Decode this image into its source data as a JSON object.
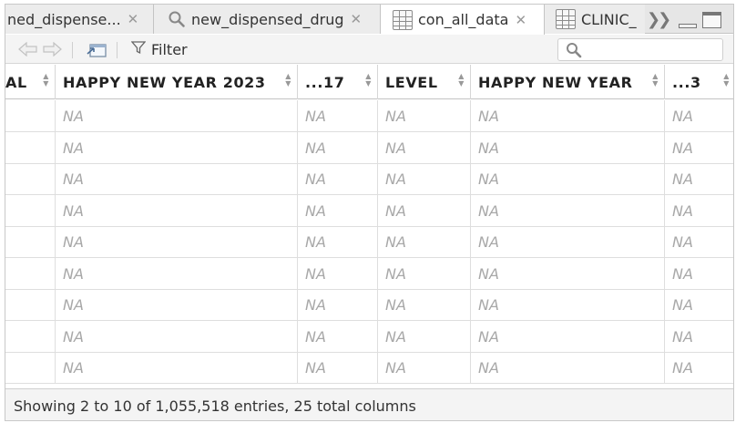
{
  "tabs": [
    {
      "label": "ned_dispense...",
      "icon": "none",
      "closable": true
    },
    {
      "label": "new_dispensed_drug",
      "icon": "search-icon",
      "closable": true
    },
    {
      "label": "con_all_data",
      "icon": "table-grid-icon",
      "closable": true,
      "active": true
    },
    {
      "label": "CLINIC_",
      "icon": "table-grid-icon",
      "closable": false
    }
  ],
  "toolbar": {
    "filter_label": "Filter",
    "search_value": ""
  },
  "table": {
    "columns": [
      {
        "label": "AL"
      },
      {
        "label": "HAPPY NEW YEAR 2023"
      },
      {
        "label": "...17"
      },
      {
        "label": "LEVEL"
      },
      {
        "label": "HAPPY NEW YEAR"
      },
      {
        "label": "...3"
      }
    ],
    "rows": [
      [
        "",
        "NA",
        "NA",
        "NA",
        "NA",
        "NA"
      ],
      [
        "",
        "NA",
        "NA",
        "NA",
        "NA",
        "NA"
      ],
      [
        "",
        "NA",
        "NA",
        "NA",
        "NA",
        "NA"
      ],
      [
        "",
        "NA",
        "NA",
        "NA",
        "NA",
        "NA"
      ],
      [
        "",
        "NA",
        "NA",
        "NA",
        "NA",
        "NA"
      ],
      [
        "",
        "NA",
        "NA",
        "NA",
        "NA",
        "NA"
      ],
      [
        "",
        "NA",
        "NA",
        "NA",
        "NA",
        "NA"
      ],
      [
        "",
        "NA",
        "NA",
        "NA",
        "NA",
        "NA"
      ],
      [
        "",
        "NA",
        "NA",
        "NA",
        "NA",
        "NA"
      ]
    ]
  },
  "footer": {
    "status": "Showing 2 to 10 of 1,055,518 entries, 25 total columns"
  }
}
